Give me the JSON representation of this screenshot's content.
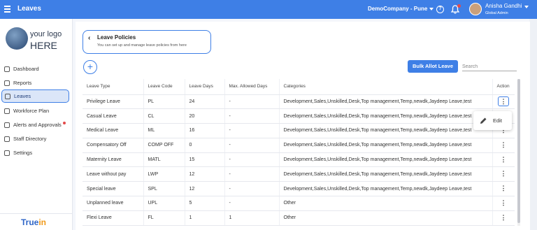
{
  "header": {
    "title": "Leaves",
    "company": "DemoCompany - Pune",
    "user_name": "Anisha Gandhi",
    "user_role": "Global Admin",
    "help_icon": "?",
    "colors": {
      "bar": "#3e7fe6",
      "notification_dot": "#e34a4a"
    }
  },
  "sidebar": {
    "logo_line1": "your logo",
    "logo_line2": "HERE",
    "items": [
      {
        "label": "Dashboard",
        "icon": "home-icon"
      },
      {
        "label": "Reports",
        "icon": "chart-icon"
      },
      {
        "label": "Leaves",
        "icon": "calendar-icon"
      },
      {
        "label": "Workforce Plan",
        "icon": "grid-icon"
      },
      {
        "label": "Alerts and Approvals",
        "icon": "bell-icon"
      },
      {
        "label": "Staff Directory",
        "icon": "people-icon"
      },
      {
        "label": "Settings",
        "icon": "gear-icon"
      }
    ],
    "brand_part1": "True",
    "brand_part2": "in"
  },
  "policies": {
    "back_icon": "‹",
    "title": "Leave Policies",
    "subtitle": "You can set up and manage leave policies from here"
  },
  "toolbar": {
    "add_label": "+",
    "bulk_label": "Bulk Allot Leave",
    "search_placeholder": "Search"
  },
  "table": {
    "headers": [
      "Leave Type",
      "Leave Code",
      "Leave Days",
      "Max. Allowed Days",
      "Categories",
      "Action"
    ],
    "rows": [
      [
        "Privilege Leave",
        "PL",
        "24",
        "-",
        "Development,Sales,Unskilled,Desk,Top management,Temp,newdk,Jaydeep Leave,test"
      ],
      [
        "Casual Leave",
        "CL",
        "20",
        "-",
        "Development,Sales,Unskilled,Desk,Top management,Temp,newdk,Jaydeep Leave,test"
      ],
      [
        "Medical Leave",
        "ML",
        "16",
        "-",
        "Development,Sales,Unskilled,Desk,Top management,Temp,newdk,Jaydeep Leave,test"
      ],
      [
        "Compensatory Off",
        "COMP OFF",
        "0",
        "-",
        "Development,Sales,Unskilled,Desk,Top management,Temp,newdk,Jaydeep Leave,test"
      ],
      [
        "Maternity Leave",
        "MATL",
        "15",
        "-",
        "Development,Sales,Unskilled,Desk,Top management,Temp,newdk,Jaydeep Leave,test"
      ],
      [
        "Leave without pay",
        "LWP",
        "12",
        "-",
        "Development,Sales,Unskilled,Desk,Top management,Temp,newdk,Jaydeep Leave,test"
      ],
      [
        "Special leave",
        "SPL",
        "12",
        "-",
        "Development,Sales,Unskilled,Desk,Top management,Temp,newdk,Jaydeep Leave,test"
      ],
      [
        "Unplanned leave",
        "UPL",
        "5",
        "-",
        "Other"
      ],
      [
        "Flexi Leave",
        "FL",
        "1",
        "1",
        "Other"
      ]
    ],
    "action_glyph": "⋮"
  },
  "action_menu": {
    "edit_label": "Edit"
  }
}
